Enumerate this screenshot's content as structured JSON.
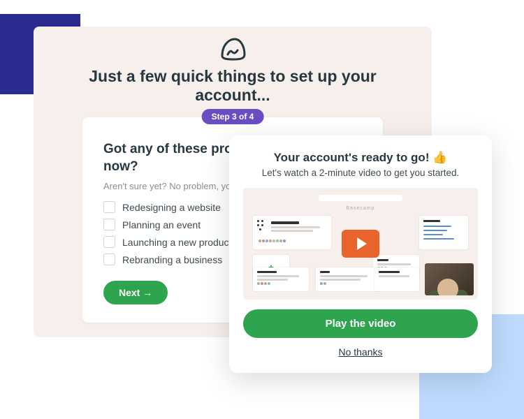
{
  "setup": {
    "title": "Just a few quick things to set up your account...",
    "step_badge": "Step 3 of 4",
    "step_heading": "Got any of these projects going right now?",
    "step_sub": "Aren't sure yet? No problem, you can skip this.",
    "options": [
      "Redesigning a website",
      "Planning an event",
      "Launching a new product",
      "Rebranding a business"
    ],
    "next_label": "Next →"
  },
  "video_modal": {
    "title": "Your account's ready to go! 👍",
    "subtitle": "Let's watch a 2-minute video to get you started.",
    "thumb_brand": "Basecamp",
    "play_label": "Play the video",
    "dismiss_label": "No thanks"
  },
  "colors": {
    "accent_green": "#2fa44f",
    "badge_purple": "#6b4dc2",
    "play_orange": "#e8642b"
  }
}
